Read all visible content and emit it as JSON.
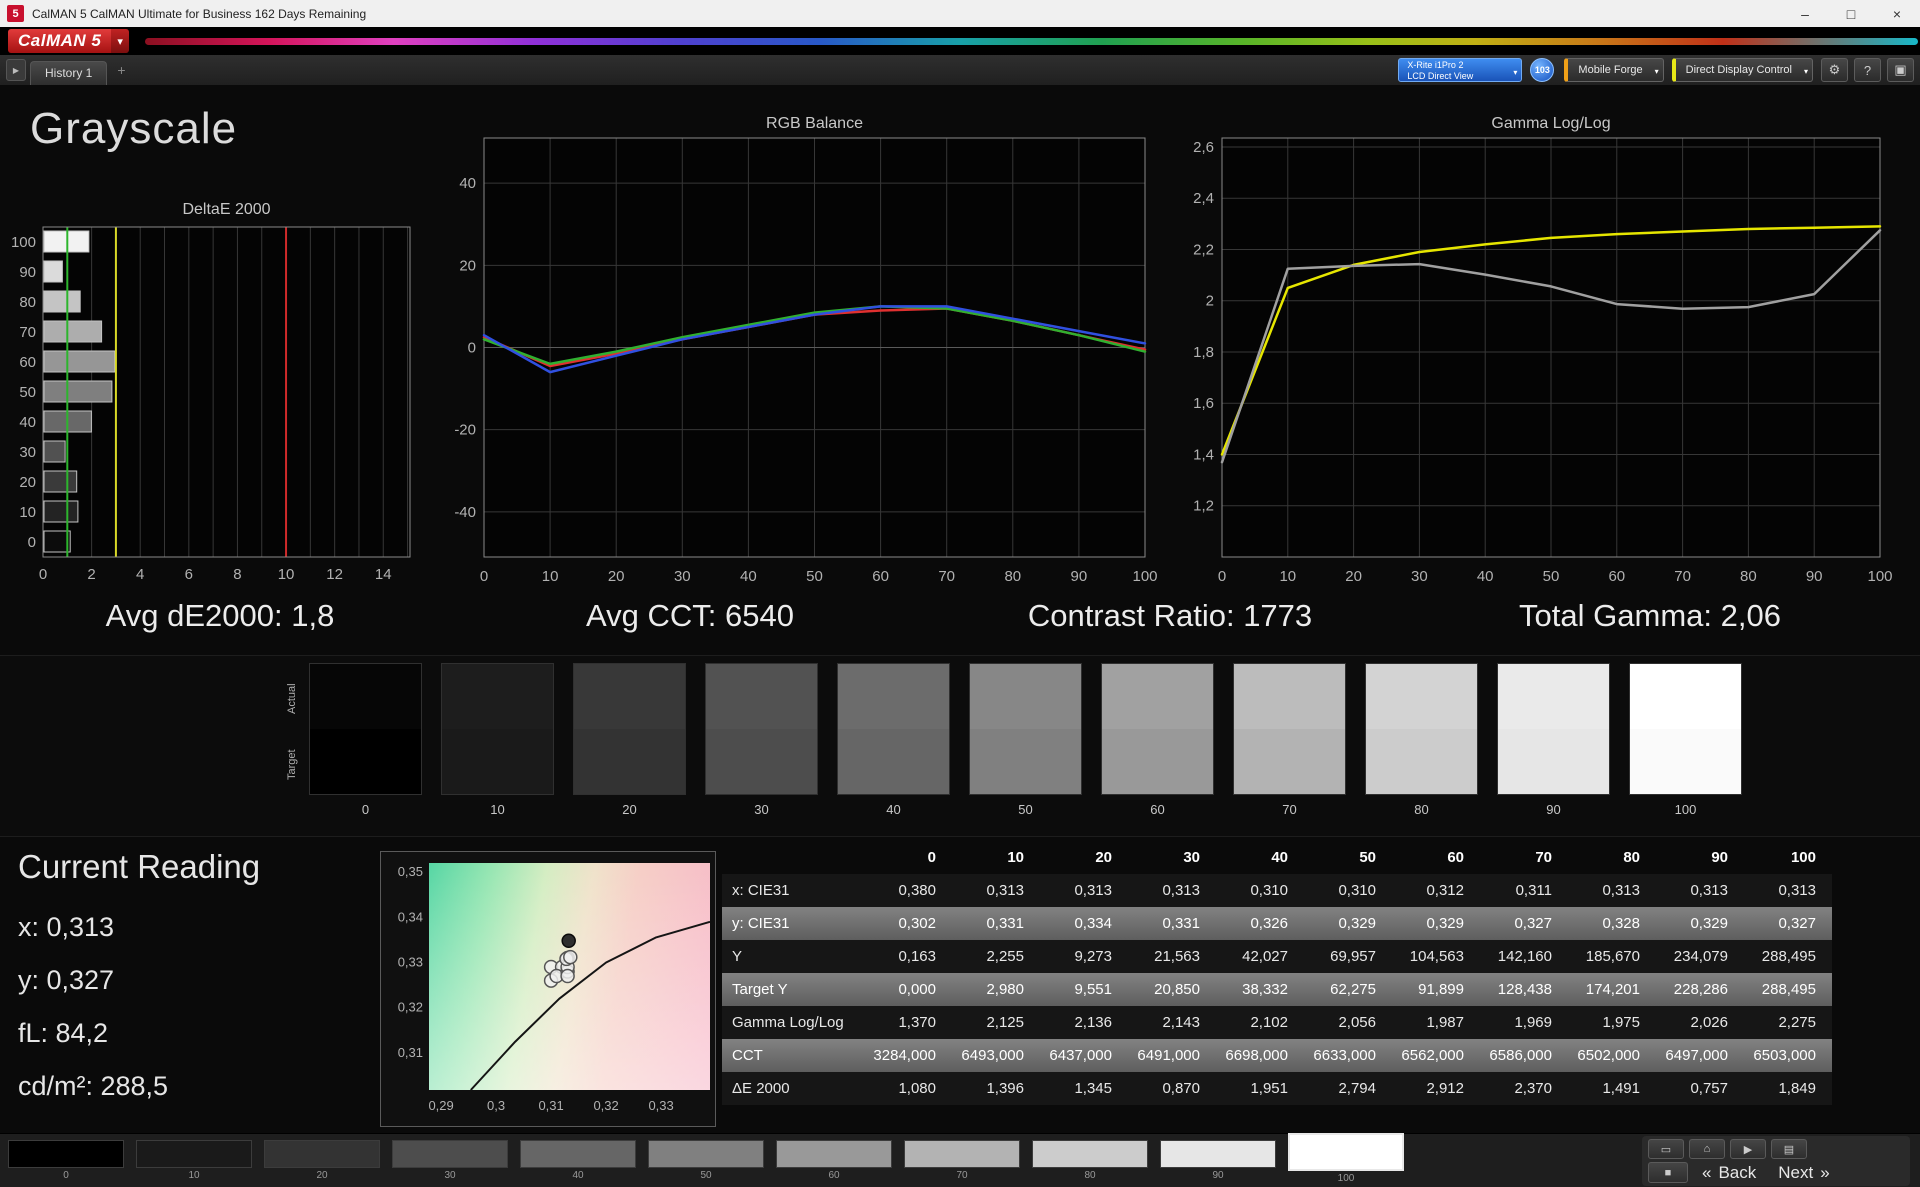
{
  "window": {
    "icon_text": "5",
    "title": "CalMAN 5 CalMAN Ultimate for Business 162 Days Remaining",
    "minimize_glyph": "–",
    "maximize_glyph": "□",
    "close_glyph": "×"
  },
  "brand": {
    "logo_text": "CalMAN 5",
    "caret": "▾"
  },
  "toolbar": {
    "expand_glyph": "▶",
    "history_tab": "History 1",
    "add_tab_glyph": "+",
    "meter_line1": "X-Rite i1Pro 2",
    "meter_line2": "LCD Direct View",
    "caret_glyph": "▾",
    "badge": "103",
    "pattern_source_label": "Mobile Forge",
    "display_control_label": "Direct Display Control",
    "settings_glyph": "⚙",
    "help_glyph": "?",
    "layout_glyph": "▣"
  },
  "page": {
    "title": "Grayscale"
  },
  "summary": {
    "avg_de2000": "Avg dE2000: 1,8",
    "avg_cct": "Avg CCT: 6540",
    "contrast_ratio": "Contrast Ratio: 1773",
    "total_gamma": "Total Gamma: 2,06"
  },
  "swatches": {
    "row_labels": [
      "Actual",
      "Target"
    ],
    "levels": [
      "0",
      "10",
      "20",
      "30",
      "40",
      "50",
      "60",
      "70",
      "80",
      "90",
      "100"
    ],
    "actual_colors": [
      "#060606",
      "#1d1d1d",
      "#383838",
      "#525252",
      "#6c6c6c",
      "#878787",
      "#a1a1a1",
      "#bcbcbc",
      "#d3d3d3",
      "#eaeaea",
      "#ffffff"
    ],
    "target_colors": [
      "#000000",
      "#1a1a1a",
      "#333333",
      "#4d4d4d",
      "#666666",
      "#808080",
      "#999999",
      "#b3b3b3",
      "#cccccc",
      "#e6e6e6",
      "#fafafa"
    ]
  },
  "current_reading": {
    "title": "Current Reading",
    "lines": [
      "x: 0,313",
      "y: 0,327",
      "fL: 84,2",
      "cd/m²: 288,5"
    ]
  },
  "table": {
    "columns": [
      "0",
      "10",
      "20",
      "30",
      "40",
      "50",
      "60",
      "70",
      "80",
      "90",
      "100"
    ],
    "rows": [
      {
        "label": "x: CIE31",
        "values": [
          "0,380",
          "0,313",
          "0,313",
          "0,313",
          "0,310",
          "0,310",
          "0,312",
          "0,311",
          "0,313",
          "0,313",
          "0,313"
        ]
      },
      {
        "label": "y: CIE31",
        "values": [
          "0,302",
          "0,331",
          "0,334",
          "0,331",
          "0,326",
          "0,329",
          "0,329",
          "0,327",
          "0,328",
          "0,329",
          "0,327"
        ]
      },
      {
        "label": "Y",
        "values": [
          "0,163",
          "2,255",
          "9,273",
          "21,563",
          "42,027",
          "69,957",
          "104,563",
          "142,160",
          "185,670",
          "234,079",
          "288,495"
        ]
      },
      {
        "label": "Target Y",
        "values": [
          "0,000",
          "2,980",
          "9,551",
          "20,850",
          "38,332",
          "62,275",
          "91,899",
          "128,438",
          "174,201",
          "228,286",
          "288,495"
        ]
      },
      {
        "label": "Gamma Log/Log",
        "values": [
          "1,370",
          "2,125",
          "2,136",
          "2,143",
          "2,102",
          "2,056",
          "1,987",
          "1,969",
          "1,975",
          "2,026",
          "2,275"
        ]
      },
      {
        "label": "CCT",
        "values": [
          "3284,000",
          "6493,000",
          "6437,000",
          "6491,000",
          "6698,000",
          "6633,000",
          "6562,000",
          "6586,000",
          "6502,000",
          "6497,000",
          "6503,000"
        ]
      },
      {
        "label": "ΔE 2000",
        "values": [
          "1,080",
          "1,396",
          "1,345",
          "0,870",
          "1,951",
          "2,794",
          "2,912",
          "2,370",
          "1,491",
          "0,757",
          "1,849"
        ]
      }
    ]
  },
  "bottom_bar": {
    "patches": [
      {
        "label": "0",
        "color": "#000000"
      },
      {
        "label": "10",
        "color": "#1a1a1a"
      },
      {
        "label": "20",
        "color": "#333333"
      },
      {
        "label": "30",
        "color": "#4d4d4d"
      },
      {
        "label": "40",
        "color": "#666666"
      },
      {
        "label": "50",
        "color": "#808080"
      },
      {
        "label": "60",
        "color": "#999999"
      },
      {
        "label": "70",
        "color": "#b3b3b3"
      },
      {
        "label": "80",
        "color": "#cccccc"
      },
      {
        "label": "90",
        "color": "#e6e6e6"
      },
      {
        "label": "100",
        "color": "#ffffff"
      }
    ],
    "selected_patch": "100",
    "stop_glyph": "■",
    "back_chevrons": "«",
    "back_label": "Back",
    "next_label": "Next",
    "next_chevrons": "»",
    "tools": [
      {
        "name": "pattern-window",
        "glyph": "▭"
      },
      {
        "name": "home",
        "glyph": "⌂"
      },
      {
        "name": "play",
        "glyph": "▶"
      },
      {
        "name": "export",
        "glyph": "▤"
      }
    ]
  },
  "chart_data": [
    {
      "id": "deltae",
      "type": "bar",
      "orientation": "horizontal",
      "title": "DeltaE 2000",
      "categories": [
        "100",
        "90",
        "80",
        "70",
        "60",
        "50",
        "40",
        "30",
        "20",
        "10",
        "0"
      ],
      "values": [
        1.849,
        0.757,
        1.491,
        2.37,
        2.912,
        2.794,
        1.951,
        0.87,
        1.345,
        1.396,
        1.08
      ],
      "xlim": [
        0,
        15.1
      ],
      "xticks": [
        0,
        2,
        4,
        6,
        8,
        10,
        12,
        14
      ],
      "xtick_labels": [
        "0",
        "2",
        "4",
        "6",
        "8",
        "10",
        "12",
        "14"
      ],
      "reference_lines": [
        {
          "x": 1,
          "color": "#2db52d"
        },
        {
          "x": 3,
          "color": "#d9d927"
        },
        {
          "x": 10,
          "color": "#cf2a2a"
        }
      ]
    },
    {
      "id": "rgb",
      "type": "line",
      "title": "RGB Balance",
      "x": [
        0,
        10,
        20,
        30,
        40,
        50,
        60,
        70,
        80,
        90,
        100
      ],
      "xticks": [
        0,
        10,
        20,
        30,
        40,
        50,
        60,
        70,
        80,
        90,
        100
      ],
      "xtick_labels": [
        "0",
        "10",
        "20",
        "30",
        "40",
        "50",
        "60",
        "70",
        "80",
        "90",
        "100"
      ],
      "ylim": [
        -51,
        51
      ],
      "yticks": [
        -40,
        -20,
        0,
        20,
        40
      ],
      "ytick_labels": [
        "-40",
        "-20",
        "0",
        "20",
        "40"
      ],
      "series": [
        {
          "name": "Red",
          "color": "#e03030",
          "values": [
            2.5,
            -4.5,
            -1.5,
            2,
            5,
            8,
            9,
            9.5,
            6.5,
            3,
            -0.5
          ]
        },
        {
          "name": "Green",
          "color": "#30b030",
          "values": [
            2,
            -4,
            -1,
            2.5,
            5.5,
            8.5,
            10,
            9.5,
            6.5,
            3,
            -1
          ]
        },
        {
          "name": "Blue",
          "color": "#3050e0",
          "values": [
            3,
            -6,
            -2,
            2,
            5,
            8,
            10,
            10,
            7,
            4,
            1
          ]
        }
      ]
    },
    {
      "id": "gamma",
      "type": "line",
      "title": "Gamma Log/Log",
      "x": [
        0,
        10,
        20,
        30,
        40,
        50,
        60,
        70,
        80,
        90,
        100
      ],
      "xticks": [
        0,
        10,
        20,
        30,
        40,
        50,
        60,
        70,
        80,
        90,
        100
      ],
      "xtick_labels": [
        "0",
        "10",
        "20",
        "30",
        "40",
        "50",
        "60",
        "70",
        "80",
        "90",
        "100"
      ],
      "ylim": [
        1.0,
        2.635
      ],
      "yticks": [
        1.2,
        1.4,
        1.6,
        1.8,
        2.0,
        2.2,
        2.4,
        2.6
      ],
      "ytick_labels": [
        "1,2",
        "1,4",
        "1,6",
        "1,8",
        "2",
        "2,2",
        "2,4",
        "2,6"
      ],
      "series": [
        {
          "name": "Target gamma",
          "color": "#e6e600",
          "values": [
            1.4,
            2.05,
            2.14,
            2.19,
            2.22,
            2.245,
            2.26,
            2.27,
            2.28,
            2.285,
            2.29
          ]
        },
        {
          "name": "Measured gamma",
          "color": "#a0a0a0",
          "values": [
            1.37,
            2.125,
            2.136,
            2.143,
            2.102,
            2.056,
            1.987,
            1.969,
            1.975,
            2.026,
            2.275
          ]
        }
      ]
    },
    {
      "id": "cie",
      "type": "scatter",
      "title": "CIE 1931 xy detail",
      "xlim": [
        0.2878,
        0.3389
      ],
      "ylim": [
        0.3018,
        0.352
      ],
      "xticks": [
        0.29,
        0.3,
        0.31,
        0.32,
        0.33
      ],
      "xtick_labels": [
        "0,29",
        "0,3",
        "0,31",
        "0,32",
        "0,33"
      ],
      "yticks": [
        0.31,
        0.32,
        0.33,
        0.34,
        0.35
      ],
      "ytick_labels": [
        "0,31",
        "0,32",
        "0,33",
        "0,34",
        "0,35"
      ],
      "points": [
        [
          0.313,
          0.331
        ],
        [
          0.31,
          0.326
        ],
        [
          0.31,
          0.329
        ],
        [
          0.312,
          0.329
        ],
        [
          0.311,
          0.327
        ],
        [
          0.313,
          0.328
        ],
        [
          0.313,
          0.329
        ],
        [
          0.313,
          0.327
        ],
        [
          0.3128,
          0.3308
        ],
        [
          0.3135,
          0.3312
        ]
      ],
      "highlight_point": [
        0.3132,
        0.3348
      ],
      "locus_curve": [
        [
          0.2954,
          0.3018
        ],
        [
          0.3035,
          0.3125
        ],
        [
          0.3115,
          0.322
        ],
        [
          0.32,
          0.33
        ],
        [
          0.329,
          0.3355
        ],
        [
          0.3389,
          0.339
        ]
      ]
    }
  ]
}
